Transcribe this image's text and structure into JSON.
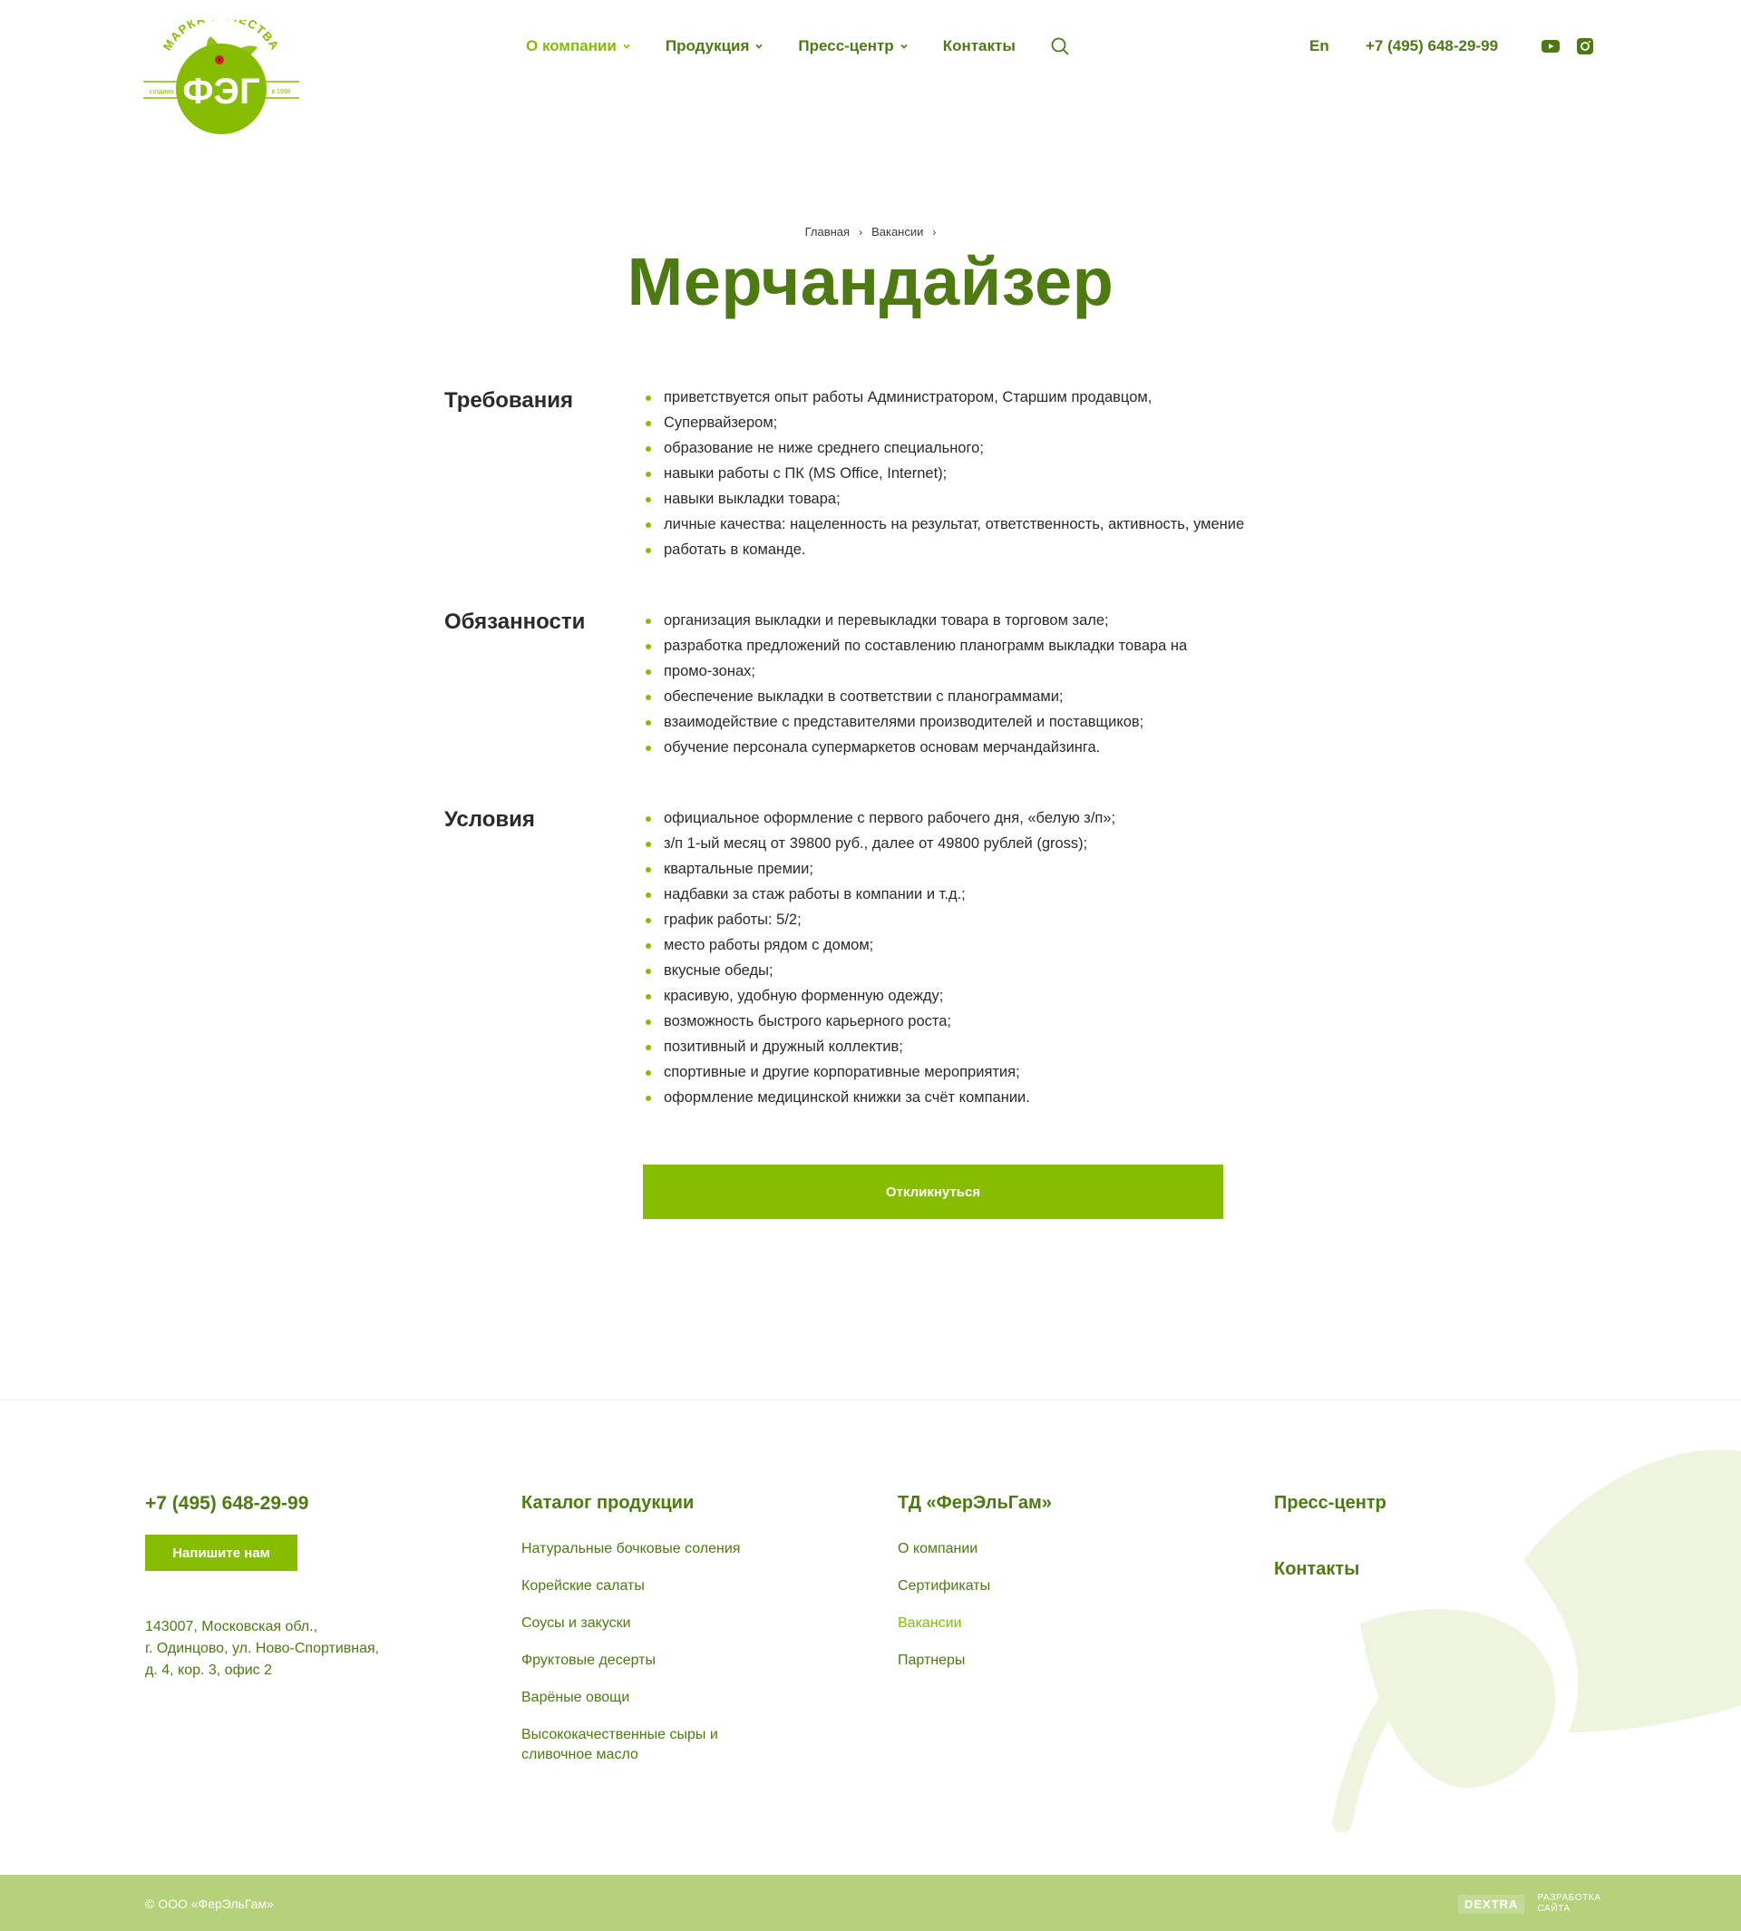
{
  "brand": {
    "logo_top_text": "МАРКА КАЧЕСТВА",
    "logo_main_text": "ФЭГ",
    "logo_left_text": "создано",
    "logo_right_text": "в 1998",
    "primary_color": "#86bd00",
    "dark_color": "#4e7a12"
  },
  "nav": {
    "items": [
      {
        "label": "О компании",
        "has_dropdown": true,
        "active": true
      },
      {
        "label": "Продукция",
        "has_dropdown": true,
        "active": false
      },
      {
        "label": "Пресс-центр",
        "has_dropdown": true,
        "active": false
      },
      {
        "label": "Контакты",
        "has_dropdown": false,
        "active": false
      }
    ],
    "search_icon": "search-icon",
    "lang": "En",
    "phone": "+7 (495) 648-29-99",
    "social": [
      "youtube-icon",
      "instagram-icon"
    ]
  },
  "breadcrumb": [
    "Главная",
    "Вакансии"
  ],
  "page": {
    "title": "Мерчандайзер"
  },
  "sections": {
    "requirements": {
      "title": "Требования",
      "items": [
        "приветствуется опыт работы Администратором, Старшим продавцом,",
        "Супервайзером;",
        "образование не ниже среднего специального;",
        "навыки работы с ПК (MS Office, Internet);",
        "навыки выкладки товара;",
        "личные качества: нацеленность на результат, ответственность, активность, умение",
        "работать в команде."
      ]
    },
    "duties": {
      "title": "Обязанности",
      "items": [
        "организация выкладки и перевыкладки товара в торговом зале;",
        "разработка предложений по составлению планограмм выкладки товара на",
        "промо-зонах;",
        "обеспечение выкладки в соответствии с планограммами;",
        "взаимодействие с представителями производителей и поставщиков;",
        "обучение персонала супермаркетов основам мерчандайзинга."
      ]
    },
    "conditions": {
      "title": "Условия",
      "items": [
        "официальное оформление с первого рабочего дня, «белую з/п»;",
        "з/п 1-ый месяц от 39800 руб., далее от 49800 рублей (gross);",
        "квартальные премии;",
        "надбавки за стаж работы в компании и т.д.;",
        "график работы: 5/2;",
        "место работы рядом с домом;",
        "вкусные обеды;",
        "красивую, удобную форменную одежду;",
        "возможность быстрого карьерного роста;",
        "позитивный и дружный коллектив;",
        "спортивные и другие корпоративные мероприятия;",
        "оформление медицинской книжки за счёт компании."
      ]
    }
  },
  "apply_button": "Откликнуться",
  "footer": {
    "phone": "+7 (495) 648-29-99",
    "write_button": "Напишите нам",
    "address": [
      "143007, Московская обл.,",
      "г. Одинцово, ул. Ново-Спортивная,",
      "д. 4, кор. 3, офис 2"
    ],
    "catalog": {
      "title": "Каталог продукции",
      "links": [
        "Натуральные бочковые соления",
        "Корейские салаты",
        "Соусы и закуски",
        "Фруктовые десерты",
        "Варёные овощи",
        "Высококачественные сыры и сливочное масло"
      ]
    },
    "company": {
      "title": "ТД «ФерЭльГам»",
      "links": [
        "О компании",
        "Сертификаты",
        "Вакансии",
        "Партнеры"
      ],
      "active_index": 2
    },
    "press": "Пресс-центр",
    "contacts": "Контакты",
    "copyright": "© ООО «ФерЭльГам»",
    "dev_logo": "DEXTRA",
    "dev_text": [
      "РАЗРАБОТКА",
      "САЙТА"
    ]
  }
}
